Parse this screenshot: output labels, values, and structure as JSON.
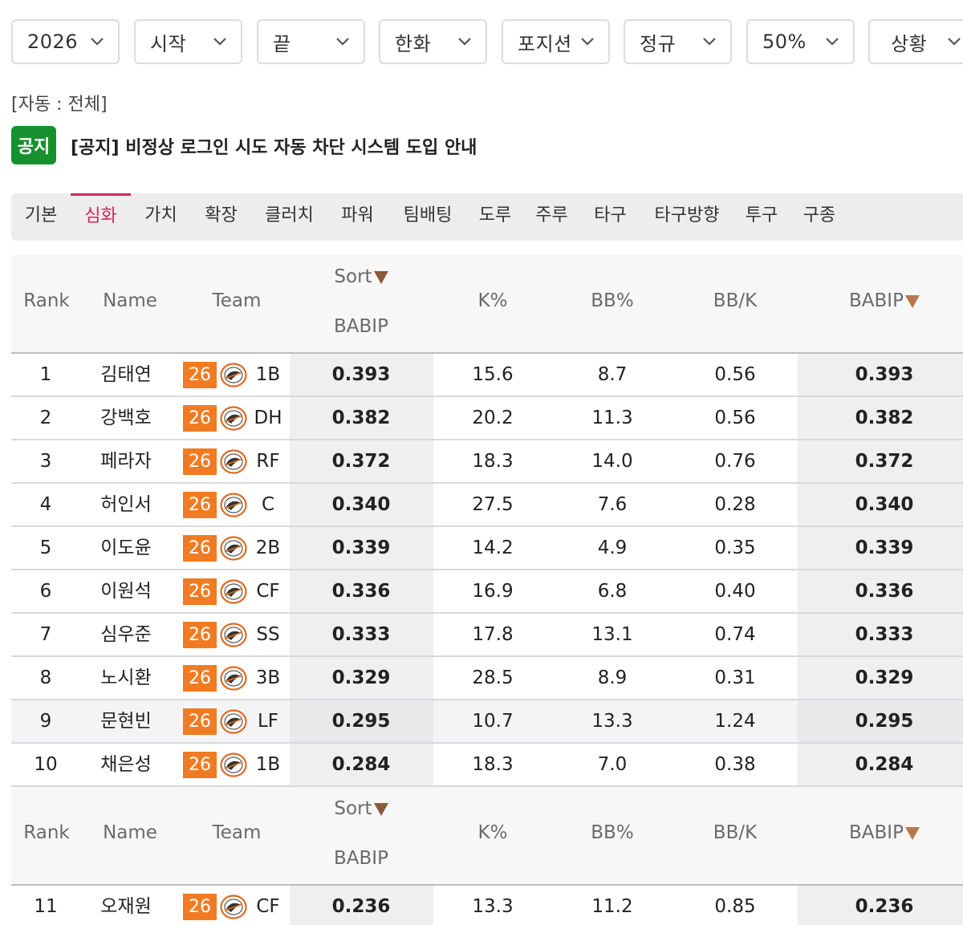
{
  "filters": [
    {
      "label": "2026"
    },
    {
      "label": "시작"
    },
    {
      "label": "끝"
    },
    {
      "label": "한화"
    },
    {
      "label": "포지션"
    },
    {
      "label": "정규"
    },
    {
      "label": "50%"
    },
    {
      "label": "상황"
    }
  ],
  "auto_label": "[자동 : 전체]",
  "notice": {
    "badge": "공지",
    "text": "[공지] 비정상 로그인 시도 자동 차단 시스템 도입 안내"
  },
  "tabs": [
    {
      "label": "기본",
      "active": false
    },
    {
      "label": "심화",
      "active": true
    },
    {
      "label": "가치",
      "active": false
    },
    {
      "label": "확장",
      "active": false
    },
    {
      "label": "클러치",
      "active": false
    },
    {
      "label": "파워",
      "active": false
    },
    {
      "label": "팀배팅",
      "active": false
    },
    {
      "label": "도루",
      "active": false
    },
    {
      "label": "주루",
      "active": false
    },
    {
      "label": "타구",
      "active": false
    },
    {
      "label": "타구방향",
      "active": false
    },
    {
      "label": "투구",
      "active": false
    },
    {
      "label": "구종",
      "active": false
    }
  ],
  "header": {
    "rank": "Rank",
    "name": "Name",
    "team": "Team",
    "sort": "Sort",
    "sort_stat": "BABIP",
    "k_pct": "K%",
    "bb_pct": "BB%",
    "bb_k": "BB/K",
    "babip": "BABIP"
  },
  "rows": [
    {
      "rank": "1",
      "name": "김태연",
      "year": "26",
      "pos": "1B",
      "sort": "0.393",
      "k": "15.6",
      "bb": "8.7",
      "bbk": "0.56",
      "babip": "0.393"
    },
    {
      "rank": "2",
      "name": "강백호",
      "year": "26",
      "pos": "DH",
      "sort": "0.382",
      "k": "20.2",
      "bb": "11.3",
      "bbk": "0.56",
      "babip": "0.382"
    },
    {
      "rank": "3",
      "name": "페라자",
      "year": "26",
      "pos": "RF",
      "sort": "0.372",
      "k": "18.3",
      "bb": "14.0",
      "bbk": "0.76",
      "babip": "0.372"
    },
    {
      "rank": "4",
      "name": "허인서",
      "year": "26",
      "pos": "C",
      "sort": "0.340",
      "k": "27.5",
      "bb": "7.6",
      "bbk": "0.28",
      "babip": "0.340"
    },
    {
      "rank": "5",
      "name": "이도윤",
      "year": "26",
      "pos": "2B",
      "sort": "0.339",
      "k": "14.2",
      "bb": "4.9",
      "bbk": "0.35",
      "babip": "0.339"
    },
    {
      "rank": "6",
      "name": "이원석",
      "year": "26",
      "pos": "CF",
      "sort": "0.336",
      "k": "16.9",
      "bb": "6.8",
      "bbk": "0.40",
      "babip": "0.336"
    },
    {
      "rank": "7",
      "name": "심우준",
      "year": "26",
      "pos": "SS",
      "sort": "0.333",
      "k": "17.8",
      "bb": "13.1",
      "bbk": "0.74",
      "babip": "0.333"
    },
    {
      "rank": "8",
      "name": "노시환",
      "year": "26",
      "pos": "3B",
      "sort": "0.329",
      "k": "28.5",
      "bb": "8.9",
      "bbk": "0.31",
      "babip": "0.329"
    },
    {
      "rank": "9",
      "name": "문현빈",
      "year": "26",
      "pos": "LF",
      "sort": "0.295",
      "k": "10.7",
      "bb": "13.3",
      "bbk": "1.24",
      "babip": "0.295"
    },
    {
      "rank": "10",
      "name": "채은성",
      "year": "26",
      "pos": "1B",
      "sort": "0.284",
      "k": "18.3",
      "bb": "7.0",
      "bbk": "0.38",
      "babip": "0.284"
    },
    {
      "rank": "11",
      "name": "오재원",
      "year": "26",
      "pos": "CF",
      "sort": "0.236",
      "k": "13.3",
      "bb": "11.2",
      "bbk": "0.85",
      "babip": "0.236"
    }
  ],
  "colors": {
    "accent": "#d2285a",
    "notice_green": "#17912f",
    "year_badge": "#f07b22"
  },
  "team_logo_icon": "eagles-logo-icon"
}
